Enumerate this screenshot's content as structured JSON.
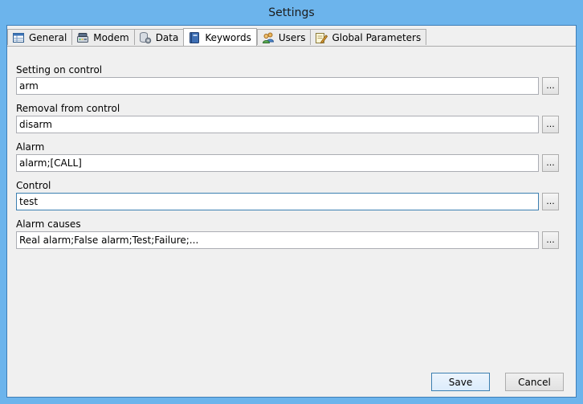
{
  "window": {
    "title": "Settings"
  },
  "tabs": [
    {
      "label": "General",
      "icon": "table-icon"
    },
    {
      "label": "Modem",
      "icon": "modem-icon"
    },
    {
      "label": "Data",
      "icon": "database-gear-icon"
    },
    {
      "label": "Keywords",
      "icon": "book-icon",
      "active": true
    },
    {
      "label": "Users",
      "icon": "users-icon"
    },
    {
      "label": "Global Parameters",
      "icon": "document-pencil-icon"
    }
  ],
  "fields": [
    {
      "label": "Setting on control",
      "value": "arm"
    },
    {
      "label": "Removal from control",
      "value": "disarm"
    },
    {
      "label": "Alarm",
      "value": "alarm;[CALL]"
    },
    {
      "label": "Control",
      "value": "test"
    },
    {
      "label": "Alarm causes",
      "value": "Real alarm;False alarm;Test;Failure;..."
    }
  ],
  "browse_label": "...",
  "buttons": {
    "save": "Save",
    "cancel": "Cancel"
  }
}
